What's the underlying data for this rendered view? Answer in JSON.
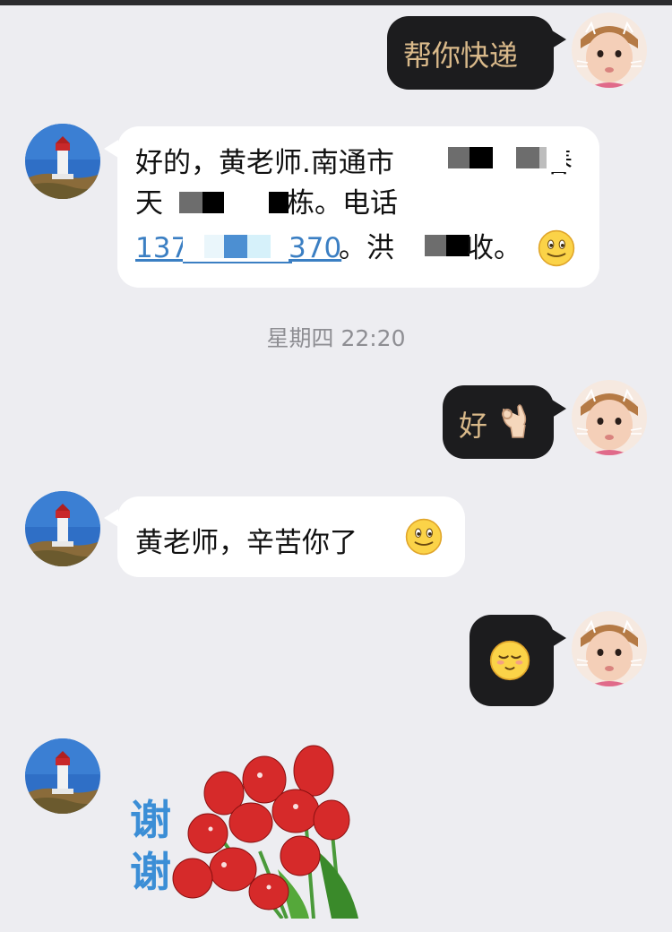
{
  "messages": {
    "m1": {
      "text": "帮你快递"
    },
    "m2": {
      "line1_a": "好的，黄老师.南通市",
      "line1_b": "春",
      "line2_a": "天",
      "line2_b": "栋。电话",
      "phone_a": "137",
      "phone_b": "370",
      "line3_c": "。洪",
      "line3_d": "收。"
    },
    "timestamp": "星期四 22:20",
    "m3": {
      "text": "好"
    },
    "m4": {
      "text": "黄老师，辛苦你了"
    },
    "sticker": {
      "word": "谢谢"
    }
  },
  "icons": {
    "ok_hand": "ok-hand-emoji",
    "smile": "smile-emoji",
    "content_face": "content-face-emoji",
    "lighthouse": "lighthouse-avatar",
    "baby": "baby-avatar"
  },
  "colors": {
    "background": "#ededf1",
    "dark_bubble": "#1c1c1e",
    "dark_bubble_text": "#d9b98a",
    "light_bubble": "#ffffff",
    "link": "#3b7fc3",
    "timestamp": "#8e8e93"
  }
}
